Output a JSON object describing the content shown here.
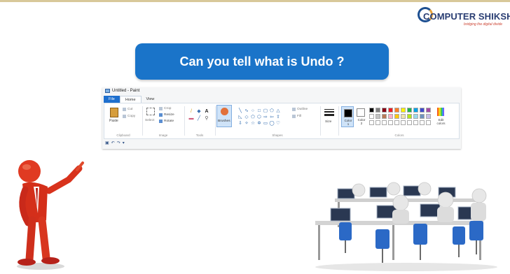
{
  "logo": {
    "name": "COMPUTER SHIKSHA",
    "tagline": "bridging the digital divide"
  },
  "banner": {
    "question": "Can you tell what is Undo ?"
  },
  "paint": {
    "window_title": "Untitled - Paint",
    "tabs": [
      "File",
      "Home",
      "View"
    ],
    "clipboard": {
      "paste": "Paste",
      "cut": "Cut",
      "copy": "Copy",
      "group": "Clipboard"
    },
    "image": {
      "select": "Select",
      "crop": "Crop",
      "resize": "Resize",
      "rotate": "Rotate",
      "group": "Image"
    },
    "tools": {
      "group": "Tools"
    },
    "brushes": {
      "label": "Brushes"
    },
    "shapes": {
      "outline": "Outline",
      "fill": "Fill",
      "group": "Shapes"
    },
    "size": {
      "label": "Size"
    },
    "colors": {
      "color1": "Color 1",
      "color2": "Color 2",
      "edit": "Edit colors",
      "group": "Colors",
      "palette": [
        "#000000",
        "#7f7f7f",
        "#880015",
        "#ed1c24",
        "#ff7f27",
        "#fff200",
        "#22b14c",
        "#00a2e8",
        "#3f48cc",
        "#a349a4",
        "#ffffff",
        "#c3c3c3",
        "#b97a57",
        "#ffaec9",
        "#ffc90e",
        "#efe4b0",
        "#b5e61d",
        "#99d9ea",
        "#7092be",
        "#c8bfe7",
        "#ffffff",
        "#ffffff",
        "#ffffff",
        "#ffffff",
        "#ffffff",
        "#ffffff",
        "#ffffff",
        "#ffffff",
        "#ffffff",
        "#ffffff"
      ]
    }
  },
  "colors": {
    "banner_bg": "#1a74c9",
    "file_tab": "#1e6fce",
    "figure_red": "#e03a22",
    "chair_blue": "#2b69c6"
  }
}
